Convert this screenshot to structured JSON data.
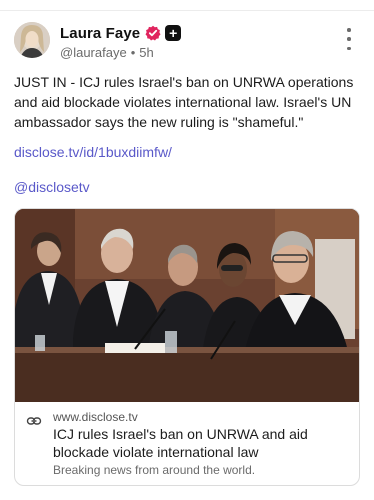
{
  "post": {
    "author": {
      "name": "Laura Faye",
      "handle": "@laurafaye",
      "separator": "•",
      "time": "5h",
      "verified_color": "#e0245e"
    },
    "text": "JUST IN - ICJ rules Israel's ban on UNRWA operations and aid blockade violates international law. Israel's UN ambassador says the new ruling is \"shameful.\"",
    "link_text": "disclose.tv/id/1buxdiimfw/",
    "mention": "@disclosetv",
    "accent_color": "#5a59c9"
  },
  "link_card": {
    "domain": "www.disclose.tv",
    "title": "ICJ rules Israel's ban on UNRWA and aid blockade violate international law",
    "description": "Breaking news from around the world.",
    "image_alt": "Judges in black robes seated at the bench of the International Court of Justice"
  },
  "icons": {
    "verified": "verified-badge-icon",
    "plus": "plus-badge-icon",
    "more": "more-options-icon",
    "link": "link-icon"
  }
}
